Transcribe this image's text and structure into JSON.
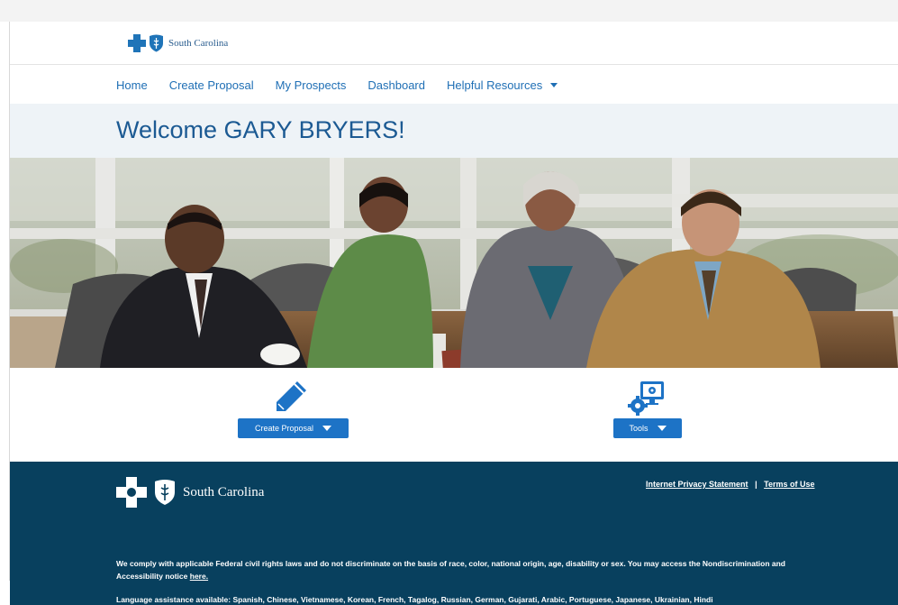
{
  "header": {
    "logo_text": "South Carolina"
  },
  "nav": {
    "items": [
      {
        "label": "Home"
      },
      {
        "label": "Create Proposal"
      },
      {
        "label": "My Prospects"
      },
      {
        "label": "Dashboard"
      },
      {
        "label": "Helpful Resources"
      }
    ]
  },
  "welcome": {
    "title": "Welcome GARY BRYERS!"
  },
  "hero": {
    "description": "photo"
  },
  "actions": {
    "create_proposal_label": "Create Proposal",
    "tools_label": "Tools"
  },
  "footer": {
    "logo_text": "South Carolina",
    "privacy_link": "Internet Privacy Statement",
    "separator": "|",
    "terms_link": "Terms of Use",
    "notice_text": "We comply with applicable Federal civil rights laws and do not discriminate on the basis of race, color, national origin, age, disability or sex. You may access the Nondiscrimination and Accessibility notice",
    "notice_link": "here.",
    "language_text": "Language assistance available: Spanish, Chinese, Vietnamese, Korean, French, Tagalog, Russian, German, Gujarati, Arabic, Portuguese, Japanese, Ukrainian, Hindi"
  },
  "colors": {
    "brand_blue": "#1f6fb5",
    "button_blue": "#1d73c6",
    "footer_navy": "#08405e",
    "welcome_band": "#eef3f7"
  }
}
